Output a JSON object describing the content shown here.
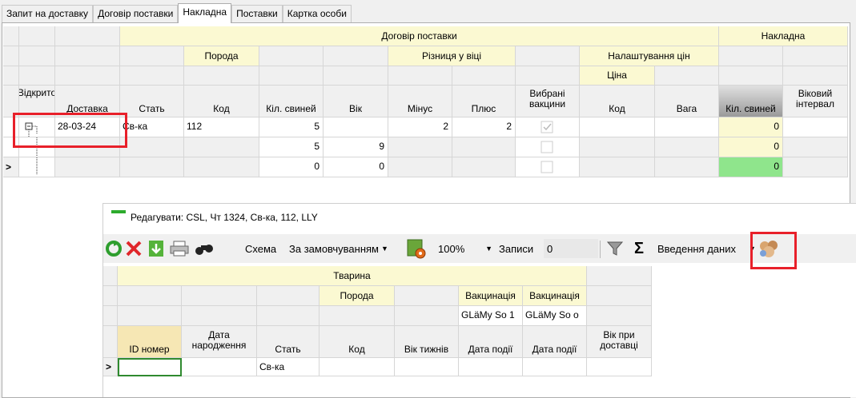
{
  "tabs": [
    "Запит на доставку",
    "Договір поставки",
    "Накладна",
    "Поставки",
    "Картка особи"
  ],
  "active_tab": 2,
  "main_grid": {
    "group_header_contract": "Договір поставки",
    "group_header_invoice": "Накладна",
    "sub_breed": "Порода",
    "sub_age_diff": "Різниця у віці",
    "sub_price_settings": "Налаштування цін",
    "sub_price": "Ціна",
    "col_open": "Відкрито",
    "col_delivery": "Доставка",
    "col_sex": "Стать",
    "col_code": "Код",
    "col_pig_count": "Кіл. свиней",
    "col_age": "Вік",
    "col_minus": "Мінус",
    "col_plus": "Плюс",
    "col_vaccines": "Вибрані вакцини",
    "col_price_code": "Код",
    "col_weight": "Вага",
    "col_invoice_count": "Кіл. свиней",
    "col_age_interval": "Віковий інтервал",
    "rows": [
      {
        "delivery": "28-03-24",
        "sex": "Св-ка",
        "code": "112",
        "count": "5",
        "age": "",
        "minus": "2",
        "plus": "2",
        "vaccine_checked": true,
        "invoice_count": "0"
      },
      {
        "delivery": "",
        "sex": "",
        "code": "",
        "count": "5",
        "age": "9",
        "minus": "",
        "plus": "",
        "vaccine_checked": false,
        "invoice_count": "0"
      },
      {
        "delivery": "",
        "sex": "",
        "code": "",
        "count": "0",
        "age": "0",
        "minus": "",
        "plus": "",
        "vaccine_checked": false,
        "invoice_count": "0"
      }
    ],
    "current_row_marker": ">"
  },
  "dialog": {
    "title": "Редагувати: CSL, Чт 1324, Св-ка, 112, LLY",
    "schema_label": "Схема",
    "schema_value": "За замовчуванням",
    "zoom": "100%",
    "records_label": "Записи",
    "records_value": "0",
    "data_entry_label": "Введення даних",
    "group_animal": "Тварина",
    "sub_breed": "Порода",
    "vacc1_header": "Вакцинація",
    "vacc2_header": "Вакцинація",
    "vacc1_name": "GLäMy So 1",
    "vacc2_name": "GLäMy So o",
    "col_id": "ID номер",
    "col_birth": "Дата народження",
    "col_sex": "Стать",
    "col_code": "Код",
    "col_age_weeks": "Вік тижнів",
    "col_event1": "Дата події",
    "col_event2": "Дата події",
    "col_age_delivery": "Вік при доставці",
    "row_sex": "Св-ка",
    "row_marker": ">"
  },
  "colors": {
    "header_yellow": "#fbf9d2",
    "green": "#8fe58c",
    "highlight_red": "#e8202a"
  }
}
